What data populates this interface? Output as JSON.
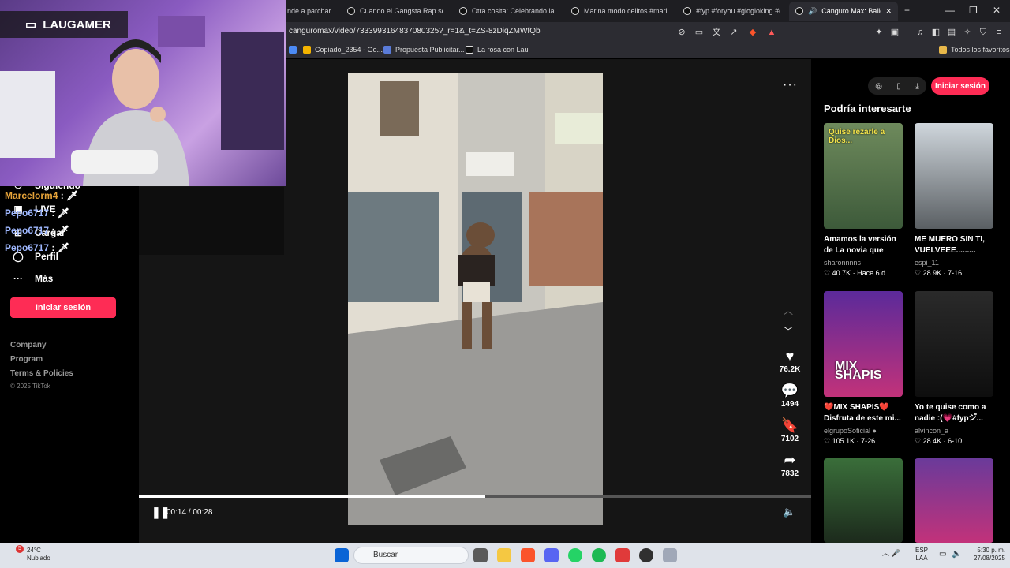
{
  "browser": {
    "tabs": [
      {
        "label": "nde a parchar e",
        "left": 0
      },
      {
        "label": "Cuando el Gangsta Rap se En",
        "left": 0
      },
      {
        "label": "Otra cosita: Celebrando la cult",
        "left": 0
      },
      {
        "label": "Marina modo celitos #marina",
        "left": 0
      },
      {
        "label": "#fyp #foryou #glogloking #em",
        "left": 0
      },
      {
        "label": "Canguro Max: Baile Ch",
        "left": 0
      }
    ],
    "new_tab": "+",
    "minimize": "—",
    "maximize": "❐",
    "close": "✕",
    "url": "canguromax/video/7333993164837080325?_r=1&_t=ZS-8zDiqZMWfQb",
    "bookmarks": [
      "Copiado_2354 - Go...",
      "Propuesta Publicitar...",
      "La rosa con Lau"
    ],
    "all_bookmarks": "Todos los favoritos",
    "shield_badge": "",
    "alert_badge": ""
  },
  "webcam": {
    "channel": "LAUGAMER"
  },
  "chat": [
    {
      "user": "Marcelorm4",
      "text": " : ",
      "color": "#e7a43a"
    },
    {
      "user": "Pepo6717",
      "text": " : ",
      "color": "#9fb8ff"
    },
    {
      "user": "Pepo6717",
      "text": " : ",
      "color": "#9fb8ff"
    },
    {
      "user": "Pepo6717",
      "text": " : ",
      "color": "#9fb8ff"
    }
  ],
  "sidebar": {
    "items": [
      {
        "label": "Siguiendo"
      },
      {
        "label": "LIVE"
      },
      {
        "label": "Cargar"
      },
      {
        "label": "Perfil"
      },
      {
        "label": "Más"
      }
    ],
    "login": "Iniciar sesión",
    "footer": [
      "Company",
      "Program",
      "Terms & Policies"
    ],
    "copyright": "© 2025 TikTok"
  },
  "video": {
    "likes": "76.2K",
    "comments": "1494",
    "saves": "7102",
    "shares": "7832",
    "time": "00:14 / 00:28",
    "progress": 0.515,
    "author": "canguromax"
  },
  "right": {
    "login": "Iniciar sesión",
    "title": "Podría interesarte",
    "cards": [
      {
        "title": "Amamos la versión de La novia que hiz...",
        "user": "sharonnnns",
        "stats": "♡ 40.7K · Hace 6 d",
        "overlay": "Quise rezarle a Dios...",
        "bg": "linear-gradient(180deg,#6e8a5c,#3d5a3a)"
      },
      {
        "title": "ME MUERO SIN TI, VUELVEEE.........",
        "user": "espi_11",
        "stats": "♡ 28.9K · 7-16",
        "overlay": "",
        "bg": "linear-gradient(180deg,#cfd6dc,#5a5f63)"
      },
      {
        "title": "❤️MIX SHAPIS❤️ Disfruta de este mi...",
        "user": "elgrupoSoficial ●",
        "stats": "♡ 105.1K · 7-26",
        "overlay": "MIX SHAPIS",
        "bg": "linear-gradient(180deg,#5b2a9a,#c2327a)"
      },
      {
        "title": "Yo te quise como a nadie :(💗#fypシ゚...",
        "user": "alvincon_a",
        "stats": "♡ 28.4K · 6-10",
        "overlay": "",
        "bg": "linear-gradient(180deg,#2a2a2a,#0e0e0e)"
      },
      {
        "title": "",
        "user": "",
        "stats": "",
        "overlay": "",
        "bg": "linear-gradient(180deg,#3a6e3a,#1c2a1c)"
      },
      {
        "title": "",
        "user": "",
        "stats": "",
        "overlay": "",
        "bg": "linear-gradient(180deg,#6a3a9a,#c2327a)"
      }
    ]
  },
  "taskbar": {
    "temp": "24°C",
    "weather": "Nublado",
    "weather_badge": "5",
    "search": "Buscar",
    "lang1": "ESP",
    "lang2": "LAA",
    "time": "5:30 p. m.",
    "date": "27/08/2025"
  },
  "colors": {
    "accent": "#fe2c55"
  }
}
